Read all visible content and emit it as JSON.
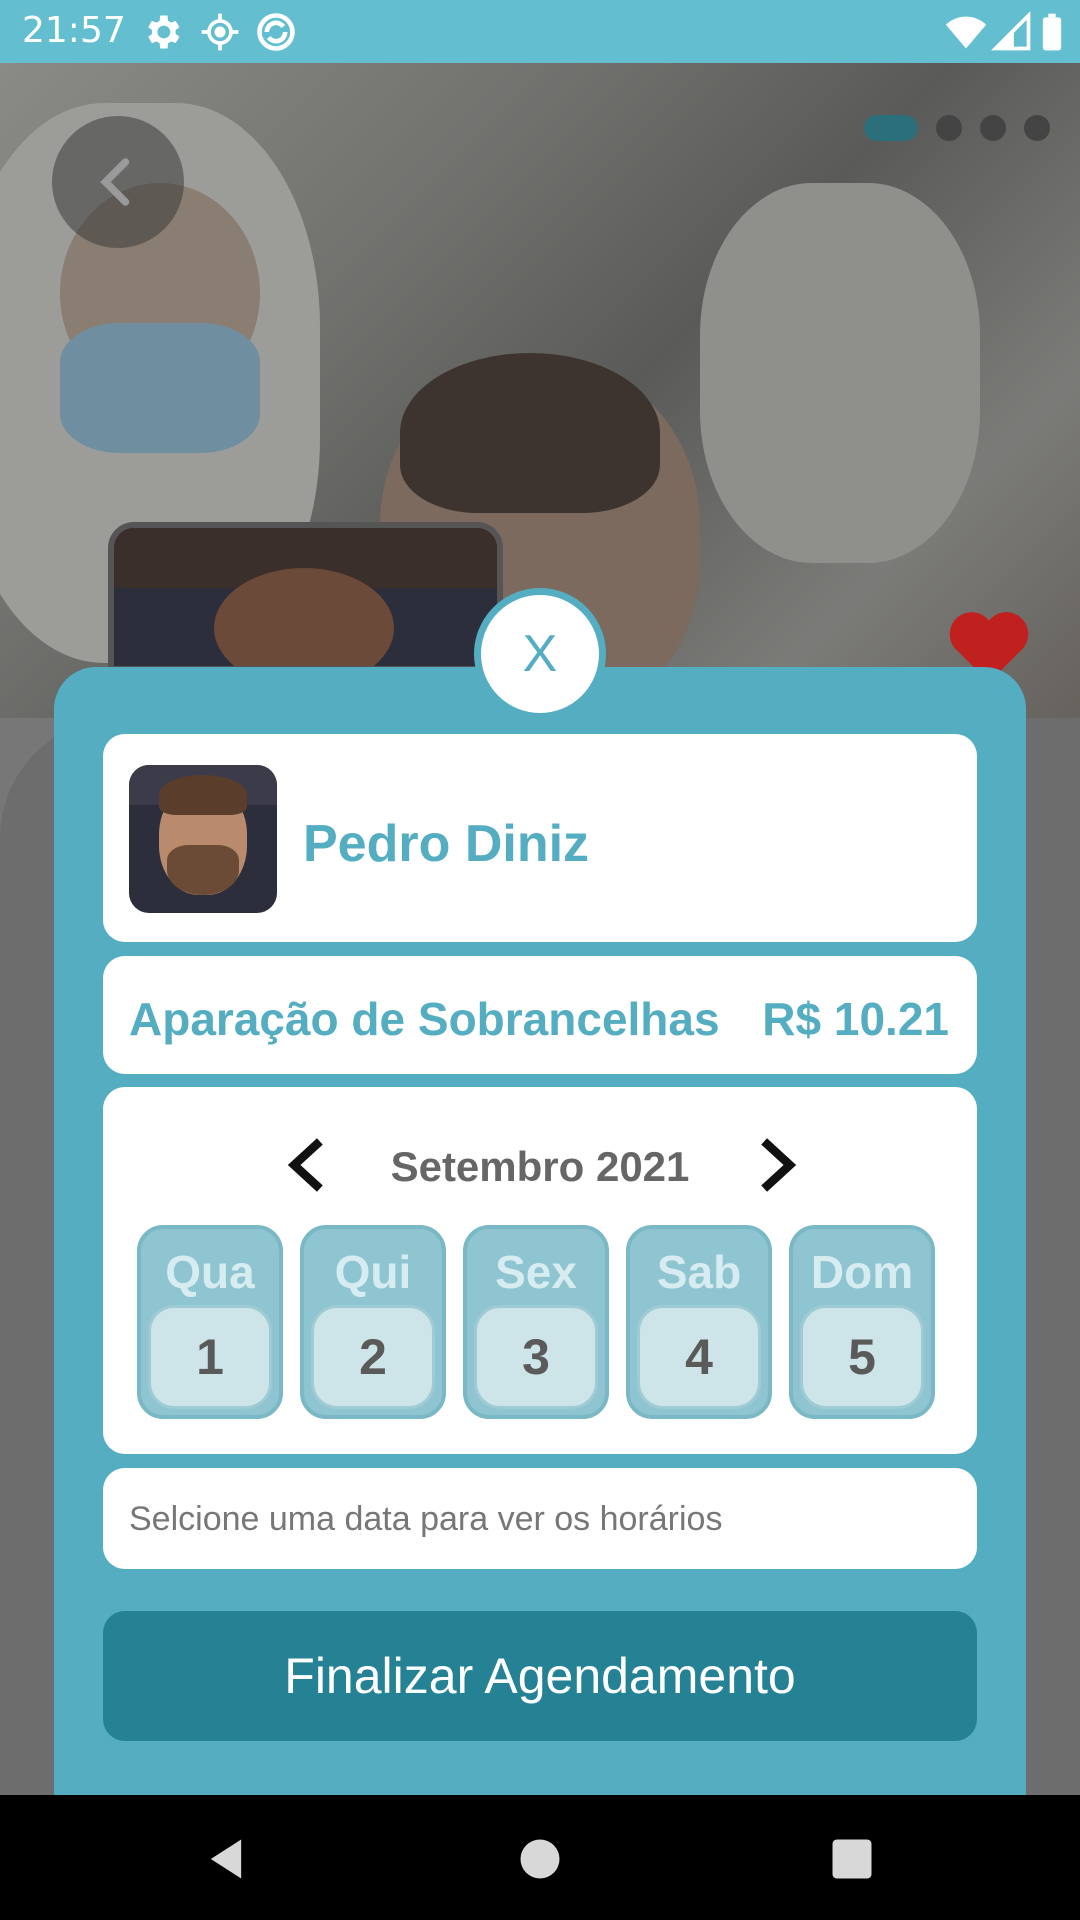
{
  "status_bar": {
    "time": "21:57",
    "icons": [
      "gear-icon",
      "location-icon",
      "sync-icon",
      "wifi-icon",
      "signal-icon",
      "battery-icon"
    ]
  },
  "hero": {
    "carousel_pages": 4,
    "carousel_active_index": 0,
    "favorite": true
  },
  "modal": {
    "close_label": "X",
    "professional": {
      "name": "Pedro Diniz"
    },
    "service": {
      "name": "Aparação de Sobrancelhas",
      "price": "R$ 10.21"
    },
    "calendar": {
      "month_label": "Setembro 2021",
      "days": [
        {
          "weekday": "Qua",
          "day": "1"
        },
        {
          "weekday": "Qui",
          "day": "2"
        },
        {
          "weekday": "Sex",
          "day": "3"
        },
        {
          "weekday": "Sab",
          "day": "4"
        },
        {
          "weekday": "Dom",
          "day": "5"
        }
      ]
    },
    "hours_placeholder": "Selcione uma data para ver os horários",
    "finish_label": "Finalizar Agendamento"
  },
  "colors": {
    "accent": "#54adc0",
    "status_bar": "#63bfd0",
    "button": "#248294",
    "heart": "#c0211f"
  }
}
